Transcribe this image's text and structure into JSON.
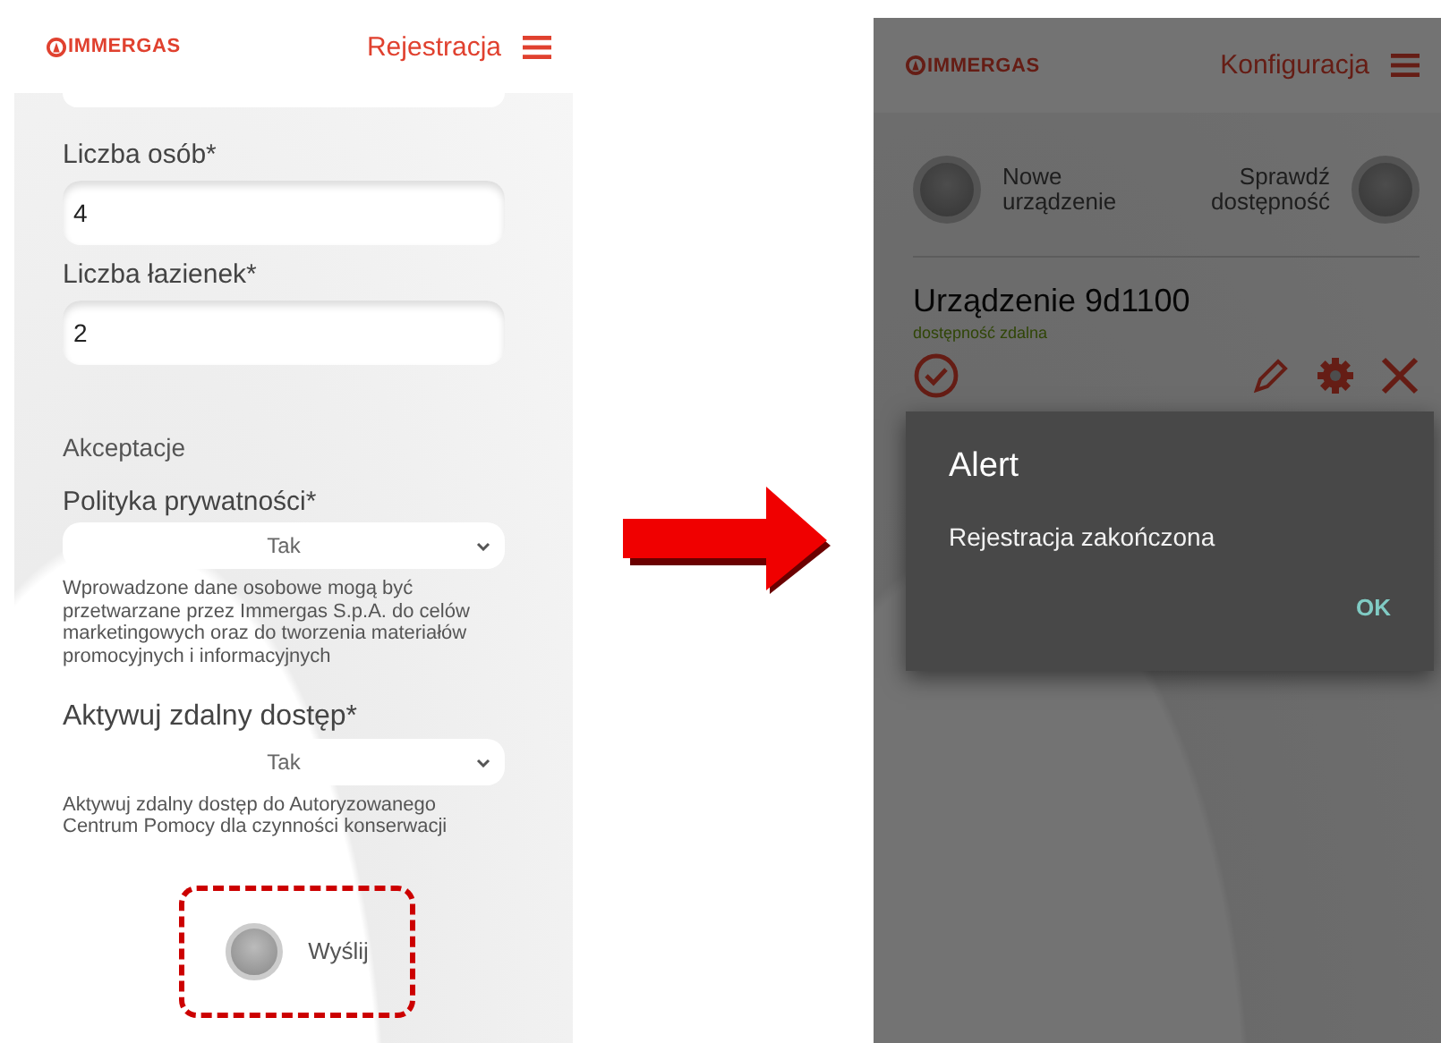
{
  "left_screen": {
    "header": {
      "logo": "IMMERGAS",
      "title": "Rejestracja"
    },
    "fields": [
      {
        "label": "Liczba osób*",
        "value": "4"
      },
      {
        "label": "Liczba łazienek*",
        "value": "2"
      }
    ],
    "section_title": "Akceptacje",
    "selects": [
      {
        "label": "Polityka prywatności*",
        "value": "Tak",
        "note": "Wprowadzone dane osobowe mogą być przetwarzane przez Immergas S.p.A. do celów marketingowych oraz do tworzenia materiałów promocyjnych i informacyjnych"
      },
      {
        "label": "Aktywuj zdalny dostęp*",
        "value": "Tak",
        "note": "Aktywuj zdalny dostęp do Autoryzowanego Centrum Pomocy dla czynności konserwacji"
      }
    ],
    "submit": {
      "label": "Wyślij"
    }
  },
  "right_screen": {
    "header": {
      "logo": "IMMERGAS",
      "title": "Konfiguracja"
    },
    "actions": [
      {
        "label": "Nowe urządzenie",
        "kind": "start"
      },
      {
        "label": "Sprawdź dostępność",
        "kind": "end"
      }
    ],
    "device": {
      "name": "Urządzenie 9d1100",
      "status": "dostępność zdalna"
    },
    "alert": {
      "title": "Alert",
      "message": "Rejestracja zakończona",
      "button": "OK"
    }
  }
}
